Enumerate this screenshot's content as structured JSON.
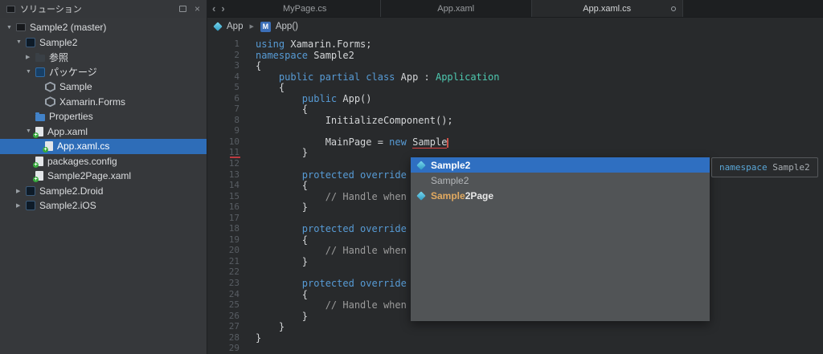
{
  "colors": {
    "selection_blue": "#2e6db8",
    "keyword_blue": "#579bd5",
    "type_teal": "#4ec9b0",
    "error_red": "#e04343",
    "popup_gray": "#515456"
  },
  "sidebar": {
    "title": "ソリューション",
    "items": [
      {
        "label": "Sample2 (master)",
        "indent": 0,
        "expander": "down",
        "icon": "solution",
        "selected": false
      },
      {
        "label": "Sample2",
        "indent": 1,
        "expander": "down",
        "icon": "project",
        "selected": false
      },
      {
        "label": "参照",
        "indent": 2,
        "expander": "right",
        "icon": "references",
        "selected": false
      },
      {
        "label": "パッケージ",
        "indent": 2,
        "expander": "down",
        "icon": "packages",
        "selected": false
      },
      {
        "label": "Sample",
        "indent": 3,
        "expander": "none",
        "icon": "package",
        "selected": false
      },
      {
        "label": "Xamarin.Forms",
        "indent": 3,
        "expander": "none",
        "icon": "package",
        "selected": false
      },
      {
        "label": "Properties",
        "indent": 2,
        "expander": "none",
        "icon": "folder",
        "selected": false
      },
      {
        "label": "App.xaml",
        "indent": 2,
        "expander": "down",
        "icon": "file-added",
        "selected": false
      },
      {
        "label": "App.xaml.cs",
        "indent": 3,
        "expander": "none",
        "icon": "file-added",
        "selected": true
      },
      {
        "label": "packages.config",
        "indent": 2,
        "expander": "none",
        "icon": "file-added",
        "selected": false
      },
      {
        "label": "Sample2Page.xaml",
        "indent": 2,
        "expander": "none",
        "icon": "file-added",
        "selected": false
      },
      {
        "label": "Sample2.Droid",
        "indent": 1,
        "expander": "right",
        "icon": "project",
        "selected": false
      },
      {
        "label": "Sample2.iOS",
        "indent": 1,
        "expander": "right",
        "icon": "project",
        "selected": false
      }
    ]
  },
  "tabs": [
    {
      "label": "MyPage.cs",
      "active": false,
      "modified": false
    },
    {
      "label": "App.xaml",
      "active": false,
      "modified": false
    },
    {
      "label": "App.xaml.cs",
      "active": true,
      "modified": true
    }
  ],
  "breadcrumb": {
    "class_name": "App",
    "member_name": "App()"
  },
  "editor": {
    "lines": [
      {
        "n": 1,
        "s": [
          [
            "k",
            "using"
          ],
          [
            "p",
            " Xamarin.Forms;"
          ]
        ]
      },
      {
        "n": 2,
        "s": [
          [
            "k",
            "namespace"
          ],
          [
            "p",
            " Sample2"
          ]
        ]
      },
      {
        "n": 3,
        "s": [
          [
            "p",
            "{"
          ]
        ]
      },
      {
        "n": 4,
        "s": [
          [
            "p",
            "    "
          ],
          [
            "k",
            "public partial class"
          ],
          [
            "p",
            " App : "
          ],
          [
            "t",
            "Application"
          ]
        ]
      },
      {
        "n": 5,
        "s": [
          [
            "p",
            "    {"
          ]
        ]
      },
      {
        "n": 6,
        "s": [
          [
            "p",
            "        "
          ],
          [
            "k",
            "public"
          ],
          [
            "p",
            " App()"
          ]
        ]
      },
      {
        "n": 7,
        "s": [
          [
            "p",
            "        {"
          ]
        ]
      },
      {
        "n": 8,
        "s": [
          [
            "p",
            "            InitializeComponent();"
          ]
        ]
      },
      {
        "n": 9,
        "s": []
      },
      {
        "n": 10,
        "s": [
          [
            "p",
            "            MainPage = "
          ],
          [
            "k",
            "new"
          ],
          [
            "p",
            " "
          ],
          [
            "e",
            "Sample"
          ],
          [
            "caret",
            ""
          ]
        ]
      },
      {
        "n": 11,
        "s": [
          [
            "p",
            "        }"
          ]
        ]
      },
      {
        "n": 12,
        "s": []
      },
      {
        "n": 13,
        "s": [
          [
            "p",
            "        "
          ],
          [
            "k",
            "protected override vo"
          ]
        ]
      },
      {
        "n": 14,
        "s": [
          [
            "p",
            "        {"
          ]
        ]
      },
      {
        "n": 15,
        "s": [
          [
            "p",
            "            "
          ],
          [
            "c",
            "// Handle when yo"
          ]
        ]
      },
      {
        "n": 16,
        "s": [
          [
            "p",
            "        }"
          ]
        ]
      },
      {
        "n": 17,
        "s": []
      },
      {
        "n": 18,
        "s": [
          [
            "p",
            "        "
          ],
          [
            "k",
            "protected override vo"
          ]
        ]
      },
      {
        "n": 19,
        "s": [
          [
            "p",
            "        {"
          ]
        ]
      },
      {
        "n": 20,
        "s": [
          [
            "p",
            "            "
          ],
          [
            "c",
            "// Handle when yo"
          ]
        ]
      },
      {
        "n": 21,
        "s": [
          [
            "p",
            "        }"
          ]
        ]
      },
      {
        "n": 22,
        "s": []
      },
      {
        "n": 23,
        "s": [
          [
            "p",
            "        "
          ],
          [
            "k",
            "protected override vo"
          ]
        ]
      },
      {
        "n": 24,
        "s": [
          [
            "p",
            "        {"
          ]
        ]
      },
      {
        "n": 25,
        "s": [
          [
            "p",
            "            "
          ],
          [
            "c",
            "// Handle when yo"
          ]
        ]
      },
      {
        "n": 26,
        "s": [
          [
            "p",
            "        }"
          ]
        ]
      },
      {
        "n": 27,
        "s": [
          [
            "p",
            "    }"
          ]
        ]
      },
      {
        "n": 28,
        "s": [
          [
            "p",
            "}"
          ]
        ]
      },
      {
        "n": 29,
        "s": []
      }
    ]
  },
  "completion": {
    "items": [
      {
        "parts": [
          [
            "sel",
            "Sample2"
          ]
        ],
        "icon": "class",
        "selected": true
      },
      {
        "parts": [
          [
            "dim",
            "Sample2"
          ]
        ],
        "icon": "none",
        "selected": false
      },
      {
        "parts": [
          [
            "hl",
            "Sample"
          ],
          [
            "norm",
            "2Page"
          ]
        ],
        "icon": "class",
        "selected": false
      }
    ],
    "tooltip": {
      "segments": [
        [
          "k",
          "namespace"
        ],
        [
          "p",
          " Sample2"
        ]
      ]
    }
  }
}
